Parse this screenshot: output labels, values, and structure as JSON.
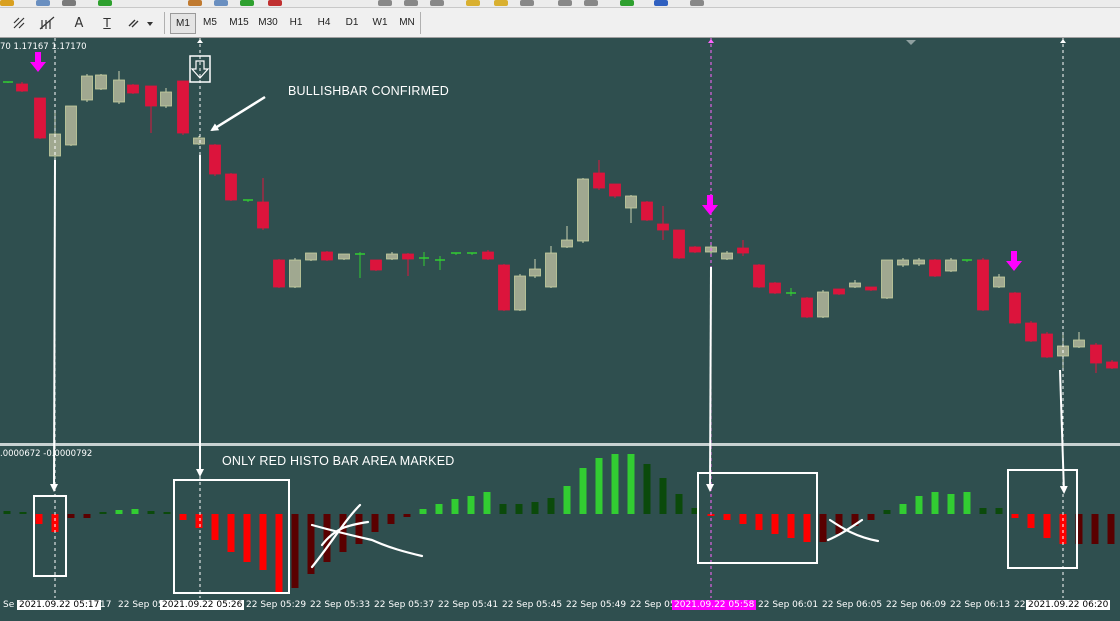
{
  "toolbar": {
    "tools": [
      "cursor-tool",
      "crosshair-tool",
      "fib-tool",
      "text-tool",
      "label-tool",
      "shapes-tool"
    ],
    "text_tool_glyph": "A",
    "label_tool_glyph": "T",
    "timeframes": [
      "M1",
      "M5",
      "M15",
      "M30",
      "H1",
      "H4",
      "D1",
      "W1",
      "MN"
    ],
    "active_timeframe": "M1"
  },
  "chart": {
    "price_readout": "70 1.17167 1.17170",
    "indicator_readout": ".0000672 -0.0000792",
    "annotations": {
      "bullish": "BULLISHBAR CONFIRMED",
      "histo": "ONLY RED HISTO BAR AREA MARKED"
    },
    "colors": {
      "background": "#2f4f4f",
      "bull_candle": "#a0a890",
      "bear_candle": "#dc143c",
      "signal_arrow": "#ff00ff",
      "histo_red": "#ff0000",
      "histo_darkred": "#5a0000",
      "histo_green": "#32cd32",
      "histo_darkgreen": "#0b4a0b"
    }
  },
  "time_axis": [
    {
      "text": "Se",
      "hl": ""
    },
    {
      "text": "2021.09.22 05:17",
      "hl": "white"
    },
    {
      "text": ":17",
      "hl": ""
    },
    {
      "text": "22 Sep 05",
      "hl": ""
    },
    {
      "text": "2021.09.22 05:26",
      "hl": "white"
    },
    {
      "text": "22 Sep 05:29",
      "hl": ""
    },
    {
      "text": "22 Sep 05:33",
      "hl": ""
    },
    {
      "text": "22 Sep 05:37",
      "hl": ""
    },
    {
      "text": "22 Sep 05:41",
      "hl": ""
    },
    {
      "text": "22 Sep 05:45",
      "hl": ""
    },
    {
      "text": "22 Sep 05:49",
      "hl": ""
    },
    {
      "text": "22 Sep 05",
      "hl": ""
    },
    {
      "text": "2021.09.22 05:58",
      "hl": "magenta"
    },
    {
      "text": "22 Sep 06:01",
      "hl": ""
    },
    {
      "text": "22 Sep 06:05",
      "hl": ""
    },
    {
      "text": "22 Sep 06:09",
      "hl": ""
    },
    {
      "text": "22 Sep 06:13",
      "hl": ""
    },
    {
      "text": "22",
      "hl": ""
    },
    {
      "text": "2021.09.22 06:20",
      "hl": "white"
    }
  ]
}
